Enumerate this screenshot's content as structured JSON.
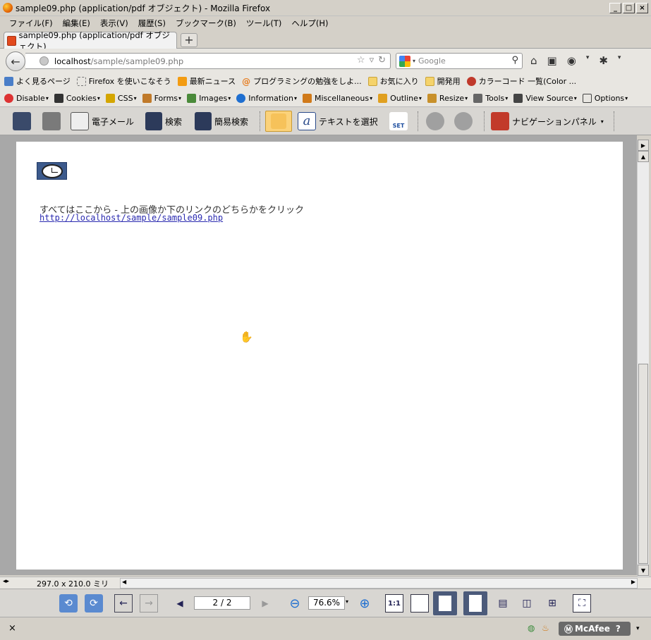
{
  "window": {
    "title": "sample09.php (application/pdf オブジェクト) - Mozilla Firefox"
  },
  "menu": [
    "ファイル(F)",
    "編集(E)",
    "表示(V)",
    "履歴(S)",
    "ブックマーク(B)",
    "ツール(T)",
    "ヘルプ(H)"
  ],
  "tab": {
    "label": "sample09.php (application/pdf オブジェクト)",
    "new_tab": "+"
  },
  "url": {
    "host": "localhost",
    "path": "/sample/sample09.php"
  },
  "search": {
    "placeholder": "Google"
  },
  "bookmarks": [
    "よく見るページ",
    "Firefox を使いこなそう",
    "最新ニュース",
    "プログラミングの勉強をしよ...",
    "お気に入り",
    "開発用",
    "カラーコード 一覧(Color ..."
  ],
  "devtools": [
    "Disable",
    "Cookies",
    "CSS",
    "Forms",
    "Images",
    "Information",
    "Miscellaneous",
    "Outline",
    "Resize",
    "Tools",
    "View Source",
    "Options"
  ],
  "pdf_toolbar": {
    "email": "電子メール",
    "search": "検索",
    "simple_search": "簡易検索",
    "select_text": "テキストを選択",
    "set": "SET",
    "nav_panel": "ナビゲーションパネル"
  },
  "document": {
    "text": "すべてはここから - 上の画像か下のリンクのどちらかをクリック",
    "link": "http://localhost/sample/sample09.php"
  },
  "status": {
    "page_size": "297.0 x 210.0 ミリ"
  },
  "pdf_nav": {
    "page": "2 / 2",
    "zoom": "76.6%",
    "actual_size": "1:1"
  },
  "addon": {
    "close": "×",
    "mcafee": "McAfee"
  },
  "colors": {
    "link": "#2a2ab0",
    "doc_bg": "#a8a8a8",
    "toolbar": "#d8d6d2"
  }
}
